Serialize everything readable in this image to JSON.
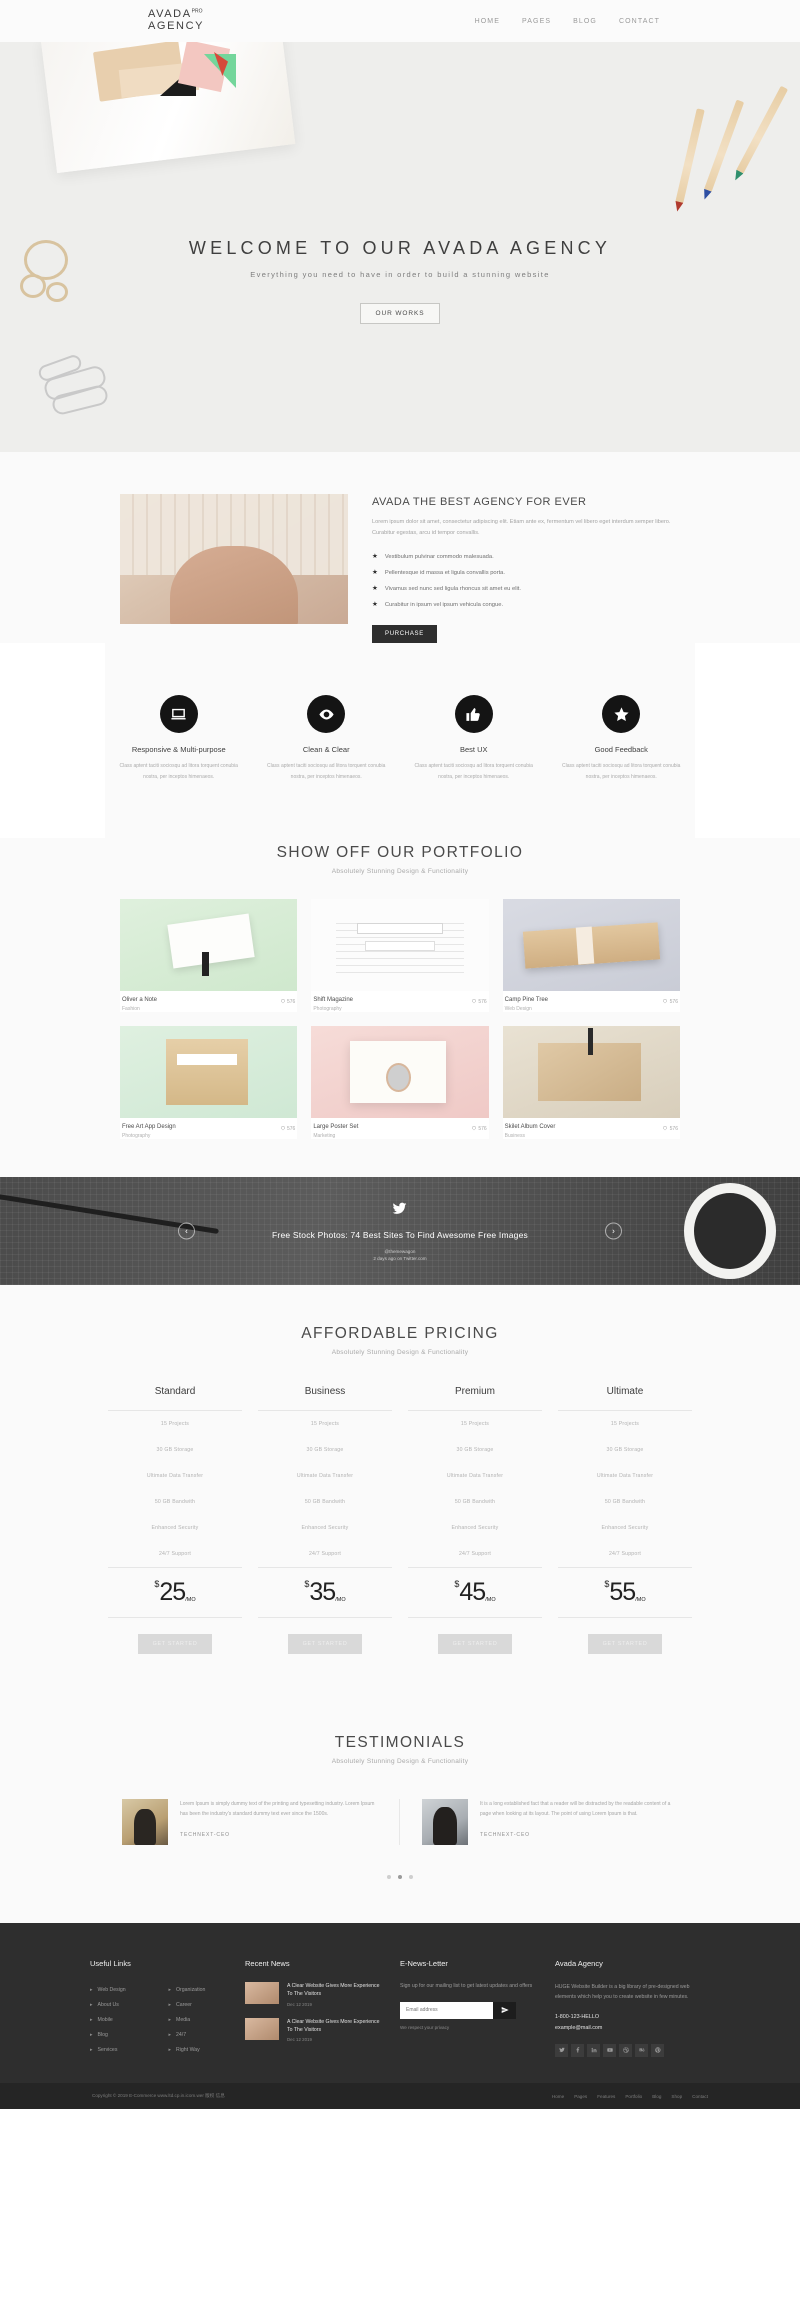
{
  "header": {
    "logo_line1": "AVADA",
    "logo_sup": "PRO",
    "logo_line2": "AGENCY",
    "nav": [
      {
        "label": "HOME"
      },
      {
        "label": "PAGES"
      },
      {
        "label": "BLOG"
      },
      {
        "label": "CONTACT"
      }
    ]
  },
  "hero": {
    "title": "WELCOME TO OUR AVADA AGENCY",
    "subtitle": "Everything you need to have in order to build a stunning website",
    "button": "OUR WORKS"
  },
  "about": {
    "title": "AVADA THE BEST AGENCY FOR EVER",
    "paragraph": "Lorem ipsum dolor sit amet, consectetur adipiscing elit. Etiam ante ex, fermentum vel libero eget interdum semper libero. Curabitur egestas, arcu id tempor convallis.",
    "bullets": [
      "Vestibulum pulvinar commodo malesuada.",
      "Pellentesque id massa et ligula convallis porta.",
      "Vivamus sed nunc sed ligula rhoncus sit amet eu elit.",
      "Curabitur in ipsum vel ipsum vehicula congue."
    ],
    "button": "PURCHASE"
  },
  "features": [
    {
      "icon": "laptop-icon",
      "title": "Responsive & Multi-purpose",
      "text": "Class aptent taciti sociosqu ad litora torquent conubia nostra, per inceptos himenaeos."
    },
    {
      "icon": "eye-icon",
      "title": "Clean & Clear",
      "text": "Class aptent taciti sociosqu ad litora torquent conubia nostra, per inceptos himenaeos."
    },
    {
      "icon": "thumbs-up-icon",
      "title": "Best UX",
      "text": "Class aptent taciti sociosqu ad litora torquent conubia nostra, per inceptos himenaeos."
    },
    {
      "icon": "star-icon",
      "title": "Good Feedback",
      "text": "Class aptent taciti sociosqu ad litora torquent conubia nostra, per inceptos himenaeos."
    }
  ],
  "portfolio": {
    "title": "SHOW OFF OUR PORTFOLIO",
    "subtitle": "Absolutely Stunning Design & Functionality",
    "items": [
      {
        "name": "Oliver a Note",
        "category": "Fashion",
        "likes": "576"
      },
      {
        "name": "Shift Magazine",
        "category": "Photography",
        "likes": "576"
      },
      {
        "name": "Camp Pine Tree",
        "category": "Web Design",
        "likes": "576"
      },
      {
        "name": "Free Art App Design",
        "category": "Photography",
        "likes": "576"
      },
      {
        "name": "Large Poster Set",
        "category": "Marketing",
        "likes": "576"
      },
      {
        "name": "Skilet Album Cover",
        "category": "Business",
        "likes": "576"
      }
    ]
  },
  "tweet": {
    "icon": "twitter-bird-icon",
    "text": "Free Stock Photos: 74 Best Sites To Find Awesome Free Images",
    "handle": "@themewagon",
    "date": "2 days ago on Twitter.com",
    "prev": "‹",
    "next": "›"
  },
  "pricing": {
    "title": "AFFORDABLE PRICING",
    "subtitle": "Absolutely Stunning Design & Functionality",
    "features": [
      "15 Projects",
      "30 GB Storage",
      "Ultimate Data Transfer",
      "50 GB Bandwith",
      "Enhanced Security",
      "24/7 Support"
    ],
    "currency": "$",
    "period": "/MO",
    "button": "GET STARTED",
    "plans": [
      {
        "name": "Standard",
        "price": "25"
      },
      {
        "name": "Business",
        "price": "35"
      },
      {
        "name": "Premium",
        "price": "45"
      },
      {
        "name": "Ultimate",
        "price": "55"
      }
    ]
  },
  "testimonials": {
    "title": "TESTIMONIALS",
    "subtitle": "Absolutely Stunning Design & Functionality",
    "items": [
      {
        "quote": "Lorem Ipsum is simply dummy text of the printing and typesetting industry. Lorem Ipsum has been the industry's standard dummy text ever since the 1500s.",
        "name": "TECHNEXT-CEO"
      },
      {
        "quote": "It is a long established fact that a reader will be distracted by the readable content of a page when looking at its layout. The point of using Lorem Ipsum is that.",
        "name": "TECHNEXT-CEO"
      }
    ]
  },
  "footer": {
    "useful_links": {
      "title": "Useful Links",
      "col1": [
        "Web Design",
        "About Us",
        "Mobile",
        "Blog",
        "Services"
      ],
      "col2": [
        "Organization",
        "Career",
        "Media",
        "24/7",
        "Right Way"
      ]
    },
    "recent_news": {
      "title": "Recent News",
      "items": [
        {
          "title": "A Clear Website Gives More Experience To The Visitors",
          "date": "Dec 12 2019"
        },
        {
          "title": "A Clear Website Gives More Experience To The Visitors",
          "date": "Dec 12 2019"
        }
      ]
    },
    "newsletter": {
      "title": "E-News-Letter",
      "desc": "Sign up for our mailing list to get latest updates and offers",
      "placeholder": "Email address",
      "note": "We respect your privacy",
      "send_icon": "paper-plane-icon"
    },
    "agency": {
      "title": "Avada Agency",
      "desc": "HUGE Website Builder is a big library of pre-designed web elements which help you to create website in few minutes.",
      "phone": "1-800-123-HELLO",
      "email": "example@mail.com",
      "socials": [
        "twitter-icon",
        "facebook-icon",
        "linkedin-icon",
        "youtube-icon",
        "dribbble-icon",
        "behance-icon",
        "pinterest-icon"
      ]
    },
    "copyright": "Copyright © 2019 E-Commerce www.ltd.cp.in.icom.wer 版权 信息",
    "copy_links": [
      "Home",
      "Pages",
      "Features",
      "Portfolio",
      "Blog",
      "Shop",
      "Contact"
    ]
  }
}
